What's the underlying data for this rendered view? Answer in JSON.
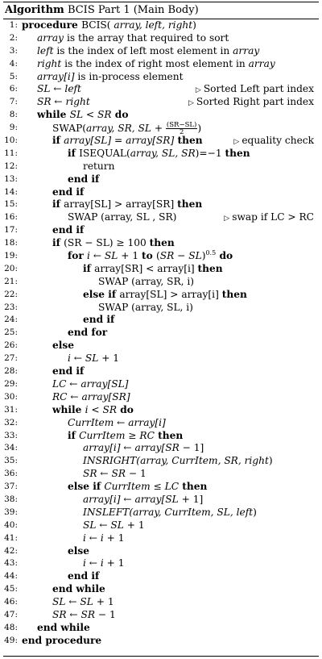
{
  "header": {
    "keyword": "Algorithm",
    "title": "BCIS Part 1 (Main Body)"
  },
  "lines": [
    {
      "n": "1:",
      "indent": 0,
      "segs": [
        [
          "b",
          "procedure "
        ],
        [
          "",
          "BCIS( "
        ],
        [
          "i",
          "array, left, right"
        ],
        [
          "",
          ")"
        ]
      ]
    },
    {
      "n": "2:",
      "indent": 1,
      "segs": [
        [
          "i",
          "array"
        ],
        [
          "",
          " is the array that required to sort"
        ]
      ]
    },
    {
      "n": "3:",
      "indent": 1,
      "segs": [
        [
          "i",
          "left"
        ],
        [
          "",
          " is the index of left most element in "
        ],
        [
          "i",
          "array"
        ]
      ]
    },
    {
      "n": "4:",
      "indent": 1,
      "segs": [
        [
          "i",
          "right"
        ],
        [
          "",
          " is the index of right most element in "
        ],
        [
          "i",
          "array"
        ]
      ]
    },
    {
      "n": "5:",
      "indent": 1,
      "segs": [
        [
          "i",
          "array[i]"
        ],
        [
          "",
          " is in-process element"
        ]
      ]
    },
    {
      "n": "6:",
      "indent": 1,
      "segs": [
        [
          "i",
          "SL"
        ],
        [
          "",
          " ← "
        ],
        [
          "i",
          "left"
        ]
      ],
      "comment": "Sorted Left part index"
    },
    {
      "n": "7:",
      "indent": 1,
      "segs": [
        [
          "i",
          "SR"
        ],
        [
          "",
          " ← "
        ],
        [
          "i",
          "right"
        ]
      ],
      "comment": "Sorted Right part index"
    },
    {
      "n": "8:",
      "indent": 1,
      "segs": [
        [
          "b",
          "while "
        ],
        [
          "i",
          "SL"
        ],
        [
          "",
          " < "
        ],
        [
          "i",
          "SR"
        ],
        [
          "b",
          " do"
        ]
      ]
    },
    {
      "n": "9:",
      "indent": 2,
      "segs": [
        [
          "",
          "SWAP("
        ],
        [
          "i",
          "array, SR, SL"
        ],
        [
          "",
          " + "
        ],
        [
          "frac",
          "(SR−SL)|2"
        ],
        [
          "",
          ")"
        ]
      ]
    },
    {
      "n": "10:",
      "indent": 2,
      "segs": [
        [
          "b",
          "if "
        ],
        [
          "i",
          "array[SL] = array[SR]"
        ],
        [
          "b",
          " then"
        ]
      ],
      "comment": "equality check"
    },
    {
      "n": "11:",
      "indent": 3,
      "segs": [
        [
          "b",
          "if "
        ],
        [
          "",
          "ISEQUAL("
        ],
        [
          "i",
          "array, SL, SR"
        ],
        [
          "",
          ")=−1 "
        ],
        [
          "b",
          "then"
        ]
      ]
    },
    {
      "n": "12:",
      "indent": 4,
      "segs": [
        [
          "",
          "return"
        ]
      ]
    },
    {
      "n": "13:",
      "indent": 3,
      "segs": [
        [
          "b",
          "end if"
        ]
      ]
    },
    {
      "n": "14:",
      "indent": 2,
      "segs": [
        [
          "b",
          "end if"
        ]
      ]
    },
    {
      "n": "15:",
      "indent": 2,
      "segs": [
        [
          "b",
          "if "
        ],
        [
          "",
          "array[SL] > array[SR] "
        ],
        [
          "b",
          "then"
        ]
      ]
    },
    {
      "n": "16:",
      "indent": 3,
      "segs": [
        [
          "",
          "SWAP (array, SL , SR)"
        ]
      ],
      "comment": "swap if LC > RC"
    },
    {
      "n": "17:",
      "indent": 2,
      "segs": [
        [
          "b",
          "end if"
        ]
      ]
    },
    {
      "n": "18:",
      "indent": 2,
      "segs": [
        [
          "b",
          "if "
        ],
        [
          "",
          "(SR − SL) ≥ 100 "
        ],
        [
          "b",
          "then"
        ]
      ]
    },
    {
      "n": "19:",
      "indent": 3,
      "segs": [
        [
          "b",
          "for "
        ],
        [
          "i",
          "i"
        ],
        [
          "",
          " ← "
        ],
        [
          "i",
          "SL"
        ],
        [
          "",
          " + 1 "
        ],
        [
          "b",
          "to "
        ],
        [
          "",
          "("
        ],
        [
          "i",
          "SR"
        ],
        [
          "",
          " − "
        ],
        [
          "i",
          "SL"
        ],
        [
          "",
          ")"
        ],
        [
          "sup",
          "0.5"
        ],
        [
          "b",
          " do"
        ]
      ]
    },
    {
      "n": "20:",
      "indent": 4,
      "segs": [
        [
          "b",
          "if "
        ],
        [
          "",
          "array[SR] < array[i] "
        ],
        [
          "b",
          "then"
        ]
      ]
    },
    {
      "n": "21:",
      "indent": 5,
      "segs": [
        [
          "",
          "SWAP (array, SR, i)"
        ]
      ]
    },
    {
      "n": "22:",
      "indent": 4,
      "segs": [
        [
          "b",
          "else if "
        ],
        [
          "",
          "array[SL] > array[i] "
        ],
        [
          "b",
          "then"
        ]
      ]
    },
    {
      "n": "23:",
      "indent": 5,
      "segs": [
        [
          "",
          "SWAP (array, SL, i)"
        ]
      ]
    },
    {
      "n": "24:",
      "indent": 4,
      "segs": [
        [
          "b",
          "end if"
        ]
      ]
    },
    {
      "n": "25:",
      "indent": 3,
      "segs": [
        [
          "b",
          "end for"
        ]
      ]
    },
    {
      "n": "26:",
      "indent": 2,
      "segs": [
        [
          "b",
          "else"
        ]
      ]
    },
    {
      "n": "27:",
      "indent": 3,
      "segs": [
        [
          "i",
          "i"
        ],
        [
          "",
          " ← "
        ],
        [
          "i",
          "SL"
        ],
        [
          "",
          " + 1"
        ]
      ]
    },
    {
      "n": "28:",
      "indent": 2,
      "segs": [
        [
          "b",
          "end if"
        ]
      ]
    },
    {
      "n": "29:",
      "indent": 2,
      "segs": [
        [
          "i",
          "LC"
        ],
        [
          "",
          " ← "
        ],
        [
          "i",
          "array[SL]"
        ]
      ]
    },
    {
      "n": "30:",
      "indent": 2,
      "segs": [
        [
          "i",
          "RC"
        ],
        [
          "",
          " ← "
        ],
        [
          "i",
          "array[SR]"
        ]
      ]
    },
    {
      "n": "31:",
      "indent": 2,
      "segs": [
        [
          "b",
          "while "
        ],
        [
          "i",
          "i"
        ],
        [
          "",
          " < "
        ],
        [
          "i",
          "SR"
        ],
        [
          "b",
          " do"
        ]
      ]
    },
    {
      "n": "32:",
      "indent": 3,
      "segs": [
        [
          "i",
          "CurrItem"
        ],
        [
          "",
          " ← "
        ],
        [
          "i",
          "array[i]"
        ]
      ]
    },
    {
      "n": "33:",
      "indent": 3,
      "segs": [
        [
          "b",
          "if "
        ],
        [
          "i",
          "CurrItem"
        ],
        [
          "",
          " ≥ "
        ],
        [
          "i",
          "RC"
        ],
        [
          "b",
          " then"
        ]
      ]
    },
    {
      "n": "34:",
      "indent": 4,
      "segs": [
        [
          "i",
          "array[i]"
        ],
        [
          "",
          " ← "
        ],
        [
          "i",
          "array[SR"
        ],
        [
          "",
          " − 1]"
        ]
      ]
    },
    {
      "n": "35:",
      "indent": 4,
      "segs": [
        [
          "i",
          "INSRIGHT(array, CurrItem, SR, right"
        ],
        [
          "",
          ")"
        ]
      ]
    },
    {
      "n": "36:",
      "indent": 4,
      "segs": [
        [
          "i",
          "SR"
        ],
        [
          "",
          " ← "
        ],
        [
          "i",
          "SR"
        ],
        [
          "",
          " − 1"
        ]
      ]
    },
    {
      "n": "37:",
      "indent": 3,
      "segs": [
        [
          "b",
          "else if "
        ],
        [
          "i",
          "CurrItem"
        ],
        [
          "",
          " ≤ "
        ],
        [
          "i",
          "LC"
        ],
        [
          "b",
          " then"
        ]
      ]
    },
    {
      "n": "38:",
      "indent": 4,
      "segs": [
        [
          "i",
          "array[i]"
        ],
        [
          "",
          " ← "
        ],
        [
          "i",
          "array[SL"
        ],
        [
          "",
          " + 1]"
        ]
      ]
    },
    {
      "n": "39:",
      "indent": 4,
      "segs": [
        [
          "i",
          "INSLEFT(array, CurrItem, SL, left"
        ],
        [
          "",
          ")"
        ]
      ]
    },
    {
      "n": "40:",
      "indent": 4,
      "segs": [
        [
          "i",
          "SL"
        ],
        [
          "",
          " ← "
        ],
        [
          "i",
          "SL"
        ],
        [
          "",
          " + 1"
        ]
      ]
    },
    {
      "n": "41:",
      "indent": 4,
      "segs": [
        [
          "i",
          "i"
        ],
        [
          "",
          " ← "
        ],
        [
          "i",
          "i"
        ],
        [
          "",
          " + 1"
        ]
      ]
    },
    {
      "n": "42:",
      "indent": 3,
      "segs": [
        [
          "b",
          "else"
        ]
      ]
    },
    {
      "n": "43:",
      "indent": 4,
      "segs": [
        [
          "i",
          "i"
        ],
        [
          "",
          " ← "
        ],
        [
          "i",
          "i"
        ],
        [
          "",
          " + 1"
        ]
      ]
    },
    {
      "n": "44:",
      "indent": 3,
      "segs": [
        [
          "b",
          "end if"
        ]
      ]
    },
    {
      "n": "45:",
      "indent": 2,
      "segs": [
        [
          "b",
          "end while"
        ]
      ]
    },
    {
      "n": "46:",
      "indent": 2,
      "segs": [
        [
          "i",
          "SL"
        ],
        [
          "",
          " ← "
        ],
        [
          "i",
          "SL"
        ],
        [
          "",
          " + 1"
        ]
      ]
    },
    {
      "n": "47:",
      "indent": 2,
      "segs": [
        [
          "i",
          "SR"
        ],
        [
          "",
          " ← "
        ],
        [
          "i",
          "SR"
        ],
        [
          "",
          " − 1"
        ]
      ]
    },
    {
      "n": "48:",
      "indent": 1,
      "segs": [
        [
          "b",
          "end while"
        ]
      ]
    },
    {
      "n": "49:",
      "indent": 0,
      "segs": [
        [
          "b",
          "end procedure"
        ]
      ]
    }
  ]
}
